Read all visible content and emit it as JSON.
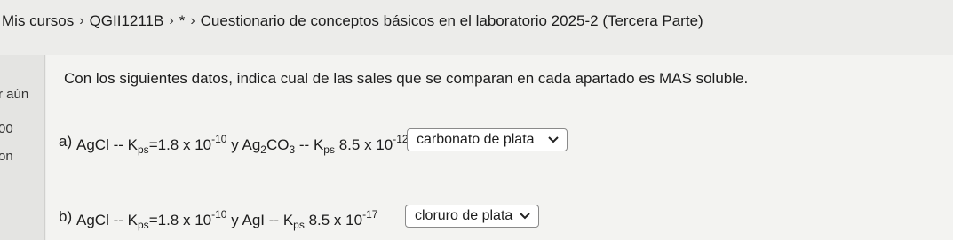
{
  "breadcrumb": {
    "items": [
      "Mis cursos",
      "QGII1211B",
      "*",
      "Cuestionario de conceptos básicos en el laboratorio 2025-2 (Tercera Parte)"
    ],
    "separator": "›"
  },
  "left_panel": {
    "fragments": [
      "r aún",
      "00",
      "on"
    ]
  },
  "question": {
    "instruction": "Con los siguientes datos, indica cual de las sales que se comparan en cada apartado es MAS soluble.",
    "parts": [
      {
        "label": "a)",
        "salt1": "AgCl",
        "dash1": "--",
        "k1": "K",
        "ksp_sub": "ps",
        "eq1": "=1.8 x 10",
        "exp1": "-10",
        "conj": "y",
        "salt2_a": "Ag",
        "salt2_sub1": "2",
        "salt2_b": "CO",
        "salt2_sub2": "3",
        "dash2": "--",
        "k2": "K",
        "ksp_sub2": "ps",
        "val2": "8.5 x 10",
        "exp2": "-12",
        "answer": "carbonato de plata"
      },
      {
        "label": "b)",
        "salt1": "AgCl",
        "dash1": "--",
        "k1": "K",
        "ksp_sub": "ps",
        "eq1": "=1.8 x 10",
        "exp1": "-10",
        "conj": "y",
        "salt2": "AgI",
        "dash2": "--",
        "k2": "K",
        "ksp_sub2": "ps",
        "val2": "8.5 x 10",
        "exp2": "-17",
        "answer": "cloruro de plata"
      }
    ]
  },
  "colors": {
    "page_bg": "#ececea",
    "card_bg": "#f3f3f1",
    "select_border": "#8a8a8a"
  }
}
